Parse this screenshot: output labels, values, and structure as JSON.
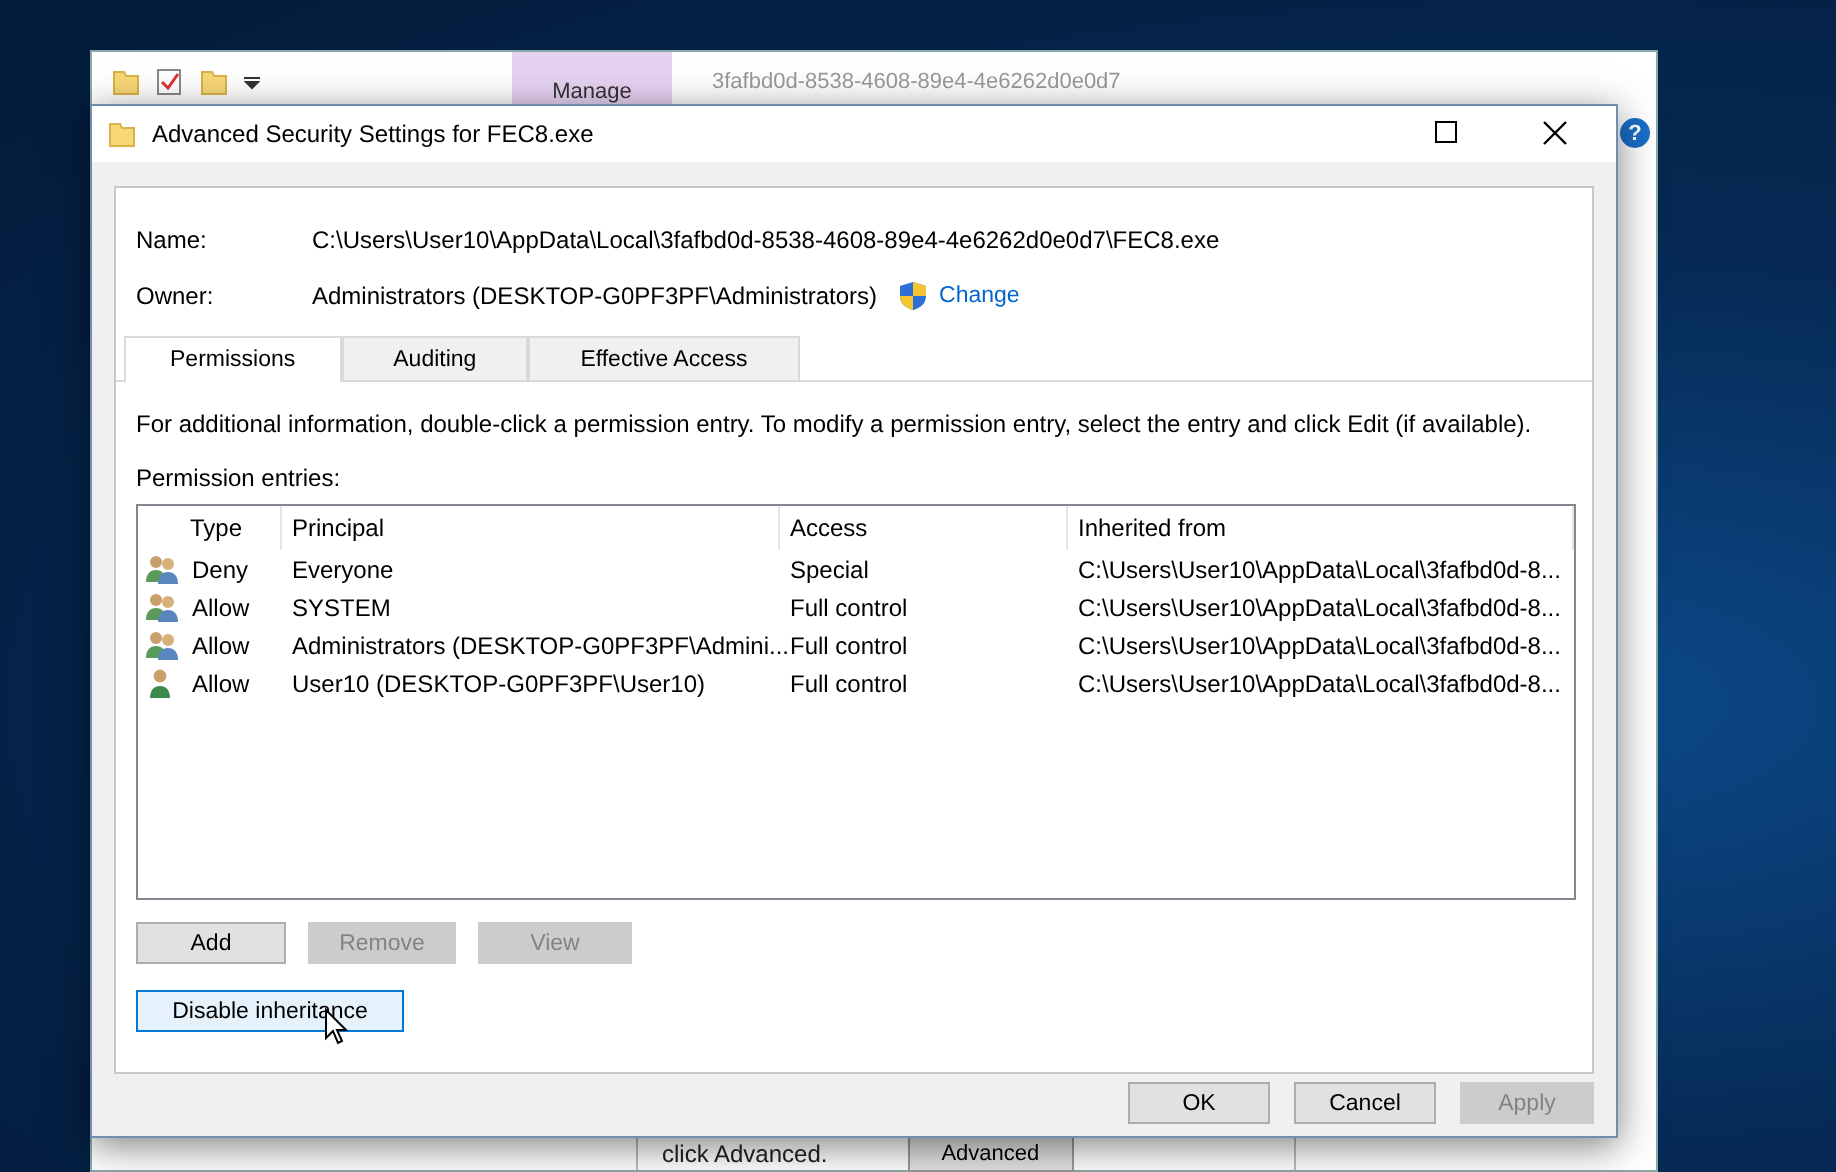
{
  "background_window": {
    "title": "3fafbd0d-8538-4608-89e4-4e6262d0e0d7",
    "ribbon_tab": "Manage",
    "help_button": "?",
    "footer_text": "click Advanced.",
    "footer_button": "Advanced"
  },
  "dialog": {
    "title": "Advanced Security Settings for FEC8.exe",
    "name_label": "Name:",
    "name_value": "C:\\Users\\User10\\AppData\\Local\\3fafbd0d-8538-4608-89e4-4e6262d0e0d7\\FEC8.exe",
    "owner_label": "Owner:",
    "owner_value": "Administrators (DESKTOP-G0PF3PF\\Administrators)",
    "change_link": "Change",
    "tabs": [
      {
        "label": "Permissions",
        "selected": true
      },
      {
        "label": "Auditing",
        "selected": false
      },
      {
        "label": "Effective Access",
        "selected": false
      }
    ],
    "info": "For additional information, double-click a permission entry. To modify a permission entry, select the entry and click Edit (if available).",
    "entries_label": "Permission entries:",
    "columns": [
      "Type",
      "Principal",
      "Access",
      "Inherited from"
    ],
    "rows": [
      {
        "kind": "group",
        "type": "Deny",
        "principal": "Everyone",
        "access": "Special",
        "inherited": "C:\\Users\\User10\\AppData\\Local\\3fafbd0d-8..."
      },
      {
        "kind": "group",
        "type": "Allow",
        "principal": "SYSTEM",
        "access": "Full control",
        "inherited": "C:\\Users\\User10\\AppData\\Local\\3fafbd0d-8..."
      },
      {
        "kind": "group",
        "type": "Allow",
        "principal": "Administrators (DESKTOP-G0PF3PF\\Admini...",
        "access": "Full control",
        "inherited": "C:\\Users\\User10\\AppData\\Local\\3fafbd0d-8..."
      },
      {
        "kind": "user",
        "type": "Allow",
        "principal": "User10 (DESKTOP-G0PF3PF\\User10)",
        "access": "Full control",
        "inherited": "C:\\Users\\User10\\AppData\\Local\\3fafbd0d-8..."
      }
    ],
    "list_buttons": [
      {
        "label": "Add",
        "disabled": false
      },
      {
        "label": "Remove",
        "disabled": true
      },
      {
        "label": "View",
        "disabled": true
      }
    ],
    "inheritance_button": {
      "label": "Disable inheritance",
      "focused": true
    },
    "footer_buttons": [
      {
        "label": "OK",
        "disabled": false
      },
      {
        "label": "Cancel",
        "disabled": false
      },
      {
        "label": "Apply",
        "disabled": true
      }
    ]
  }
}
